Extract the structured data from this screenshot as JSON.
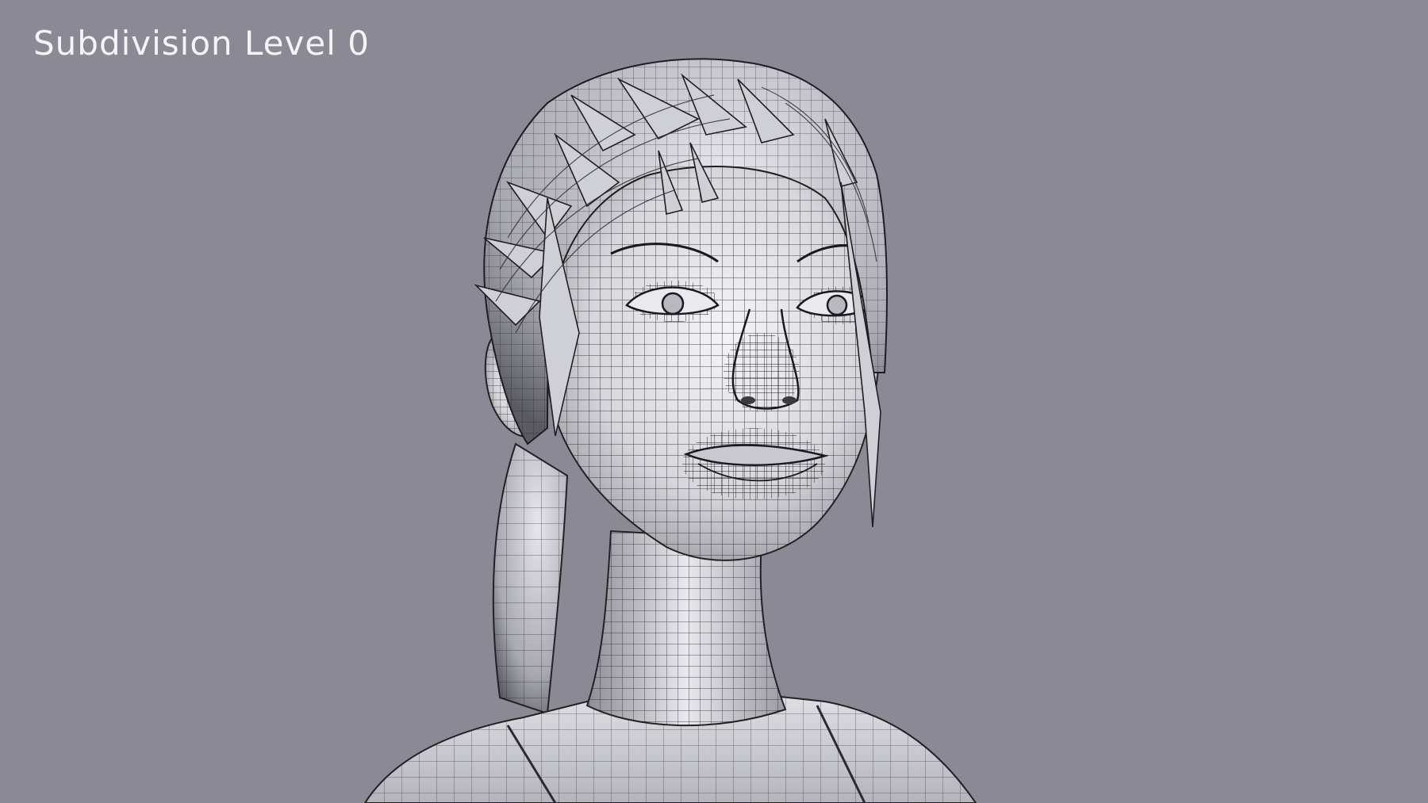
{
  "viewport": {
    "overlay_label": "Subdivision Level 0"
  },
  "colors": {
    "background": "#8b8a94",
    "mesh_fill": "#dcdce2",
    "mesh_lines": "#1e1e22",
    "label_text": "#f4f4f6"
  }
}
